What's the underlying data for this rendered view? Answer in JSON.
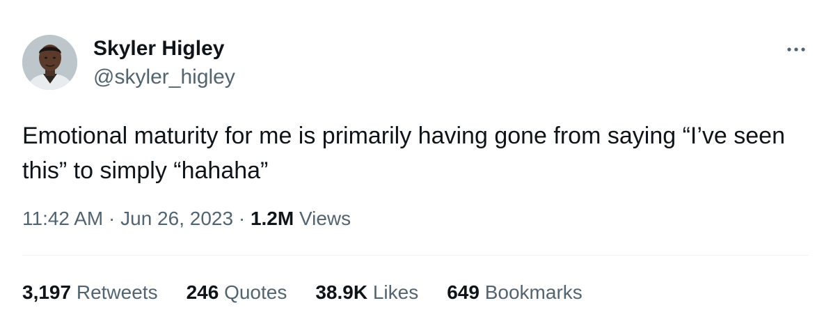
{
  "author": {
    "name": "Skyler Higley",
    "handle": "@skyler_higley"
  },
  "more_icon": "more-horizontal-icon",
  "tweet": {
    "text": "Emotional maturity for me is primarily having gone from saying “I’ve seen this” to simply “hahaha”"
  },
  "meta": {
    "time": "11:42 AM",
    "separator1": " · ",
    "date": "Jun 26, 2023",
    "separator2": " · ",
    "views_count": "1.2M",
    "views_label": " Views"
  },
  "stats": {
    "retweets": {
      "count": "3,197",
      "label": " Retweets"
    },
    "quotes": {
      "count": "246",
      "label": " Quotes"
    },
    "likes": {
      "count": "38.9K",
      "label": " Likes"
    },
    "bookmarks": {
      "count": "649",
      "label": " Bookmarks"
    }
  },
  "colors": {
    "primary_text": "#0f1419",
    "secondary_text": "#536471",
    "divider": "#eff3f4"
  }
}
